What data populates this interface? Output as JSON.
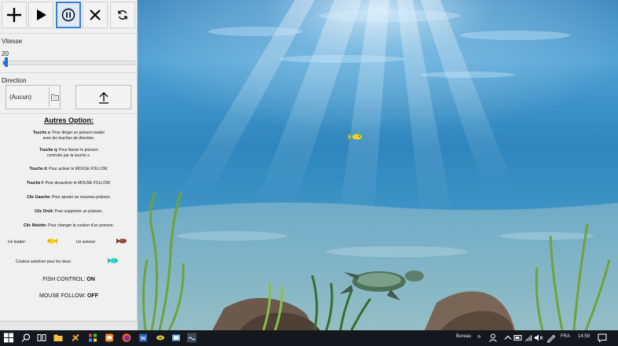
{
  "toolbar": {
    "buttons": [
      {
        "name": "add",
        "icon": "plus-icon",
        "active": false
      },
      {
        "name": "play",
        "icon": "play-icon",
        "active": false
      },
      {
        "name": "pause",
        "icon": "pause-icon",
        "active": true
      },
      {
        "name": "close",
        "icon": "close-icon",
        "active": false
      },
      {
        "name": "refresh",
        "icon": "refresh-icon",
        "active": false
      }
    ]
  },
  "speed": {
    "label": "Vitesse",
    "value": "20",
    "slider_level": 0.02,
    "accent_color": "#1e6fd6"
  },
  "direction": {
    "label": "Direction",
    "combo_value": "(Aucun)",
    "combo_icon": "folder-icon",
    "button_icon": "upload-arrow-icon"
  },
  "options": {
    "title": "Autres Option:",
    "items": [
      {
        "key": "Touche s:",
        "text": " Pour diriger un poisson leader",
        "text2_prefix": "avec ",
        "text2_em": "les touches de direction."
      },
      {
        "key": "Touche q:",
        "text": " Pour liberer le poisson",
        "text2_prefix": "controler par ",
        "text2_em": "la touche s."
      },
      {
        "key": "Touche d:",
        "text": " Pour activer le MOUSE FOLLOW."
      },
      {
        "key": "Touche f:",
        "text": " Pour desactiver le MOUSE FOLLOW."
      },
      {
        "key": "Clic Gauche:",
        "text": " Pour ajouter un nouveau poisson."
      },
      {
        "key": "Clic Droit:",
        "text": " Pour supprimer un poisson."
      },
      {
        "key": "Clic Molette:",
        "text": " Pour changer la couleur d'un poisson."
      }
    ],
    "leader_label": "Un leader:",
    "follower_label": "Un suiveur:",
    "shared_color_label": "Couleur autoriser pour les deux:",
    "leader_color": "#f2d21a",
    "follower_color": "#a04a3a",
    "shared_color": "#2ad4c8"
  },
  "status": {
    "fish_control_label": "FISH CONTROL: ",
    "fish_control_value": "ON",
    "mouse_follow_label": "MOUSE FOLLOW: ",
    "mouse_follow_value": "OFF"
  },
  "taskbar": {
    "icons": [
      "windows-start-icon",
      "search-icon",
      "task-view-icon",
      "file-explorer-icon",
      "app-icon-1",
      "app-icon-2",
      "app-icon-3",
      "firefox-icon",
      "word-icon",
      "app-icon-4",
      "app-icon-5",
      "app-icon-6"
    ],
    "desktop_label": "Bureau",
    "chevron": "»",
    "language": "FRA",
    "time": "14:59"
  }
}
